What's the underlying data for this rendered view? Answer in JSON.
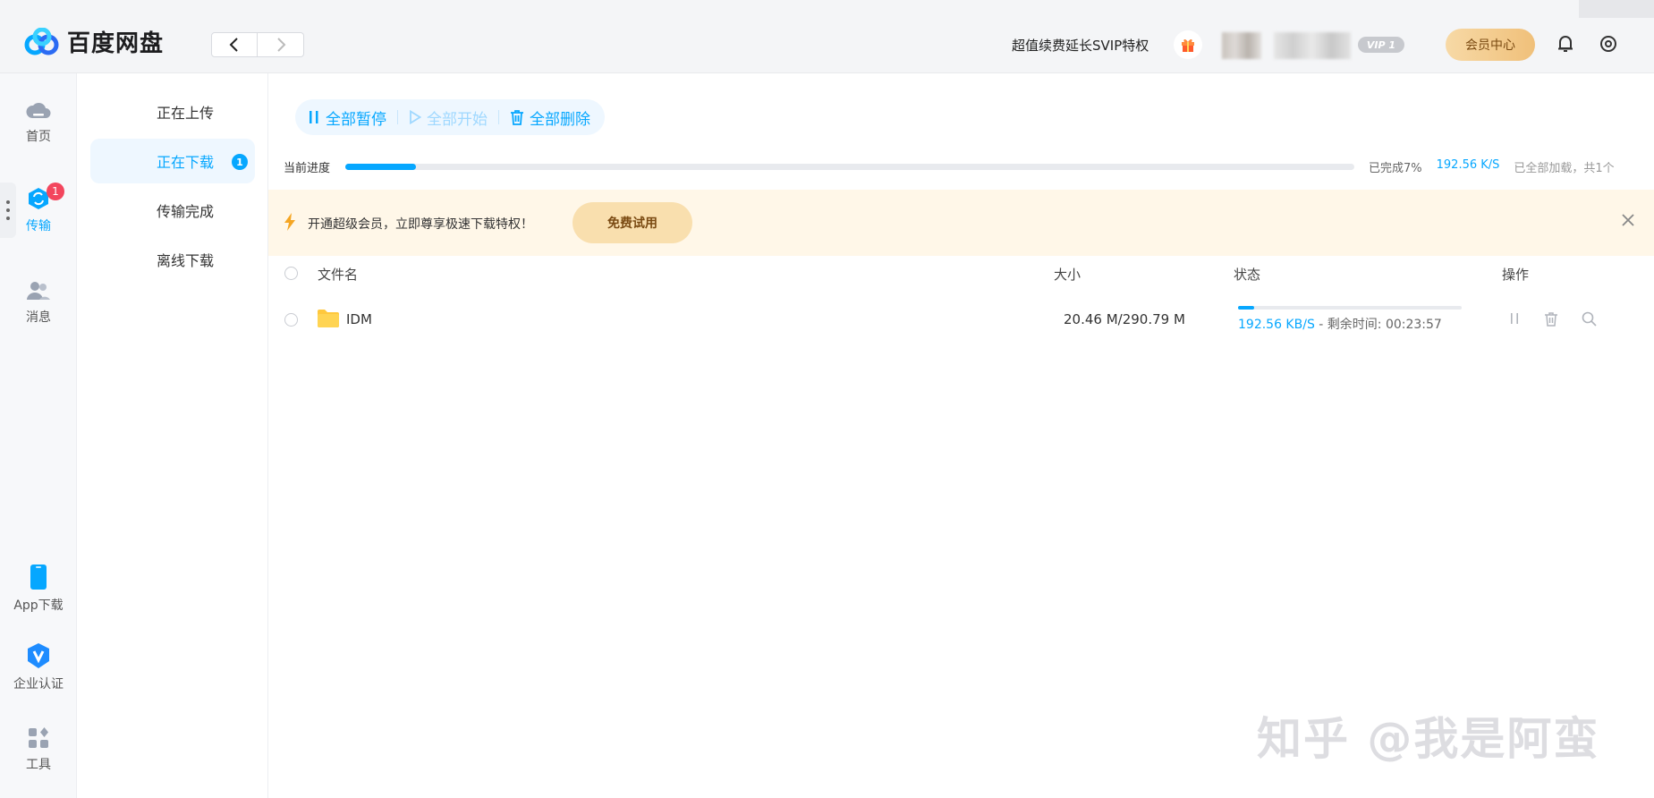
{
  "header": {
    "brand": "百度网盘",
    "promo_text": "超值续费延长SVIP特权",
    "vip_badge": "VIP 1",
    "member_center": "会员中心"
  },
  "rail": {
    "home": "首页",
    "transfer": "传输",
    "transfer_badge": "1",
    "messages": "消息",
    "app_download": "App下载",
    "enterprise": "企业认证",
    "tools": "工具"
  },
  "subnav": {
    "uploading": "正在上传",
    "downloading": "正在下载",
    "downloading_badge": "1",
    "completed": "传输完成",
    "offline": "离线下载"
  },
  "toolbar": {
    "pause_all": "全部暂停",
    "start_all": "全部开始",
    "delete_all": "全部删除"
  },
  "progress": {
    "label": "当前进度",
    "percent": 7,
    "done_text": "已完成7%",
    "speed": "192.56 K/S",
    "loaded_text": "已全部加载，共1个"
  },
  "banner": {
    "text": "开通超级会员，立即尊享极速下载特权！",
    "trial_button": "免费试用"
  },
  "table": {
    "headers": {
      "name": "文件名",
      "size": "大小",
      "status": "状态",
      "actions": "操作"
    },
    "rows": [
      {
        "name": "IDM",
        "size": "20.46 M/290.79 M",
        "progress": 7,
        "speed": "192.56 KB/S",
        "remaining": " - 剩余时间: 00:23:57"
      }
    ]
  },
  "watermark": "知乎 @我是阿蛮",
  "colors": {
    "accent": "#06a7ff",
    "badge_red": "#f3465d",
    "banner_bg": "#fff7e8",
    "trial_btn": "#f9dfae",
    "member_gold": "#f0c07a"
  }
}
